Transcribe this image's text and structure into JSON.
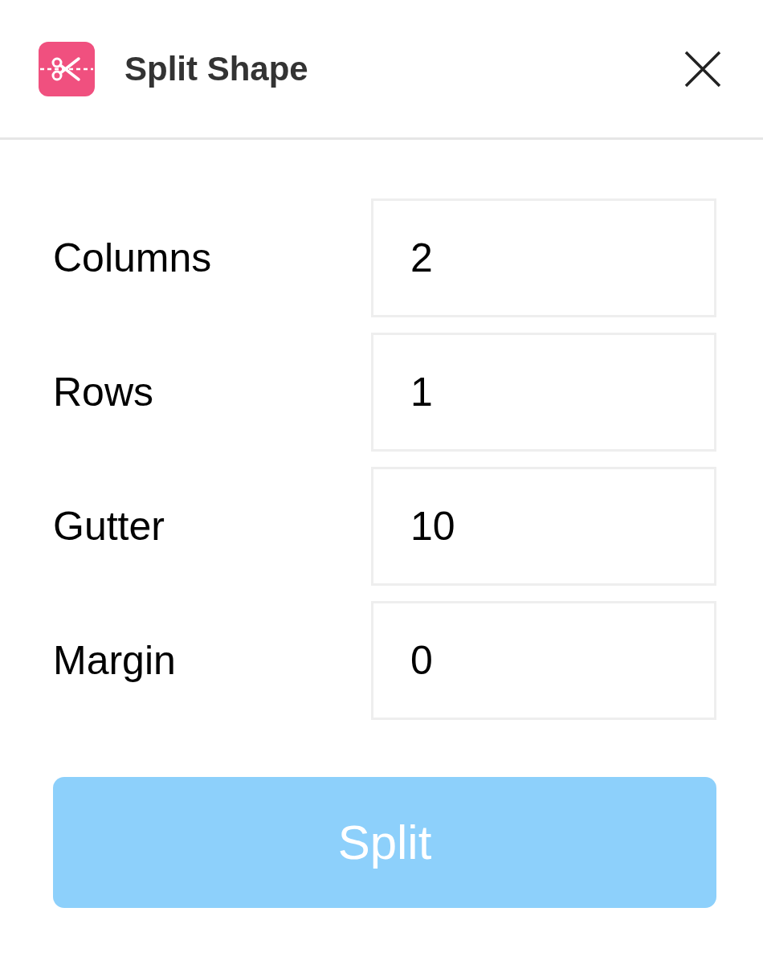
{
  "window": {
    "title": "Split Shape"
  },
  "fields": [
    {
      "label": "Columns",
      "value": "2"
    },
    {
      "label": "Rows",
      "value": "1"
    },
    {
      "label": "Gutter",
      "value": "10"
    },
    {
      "label": "Margin",
      "value": "0"
    }
  ],
  "button": {
    "label": "Split",
    "disabled": true
  }
}
